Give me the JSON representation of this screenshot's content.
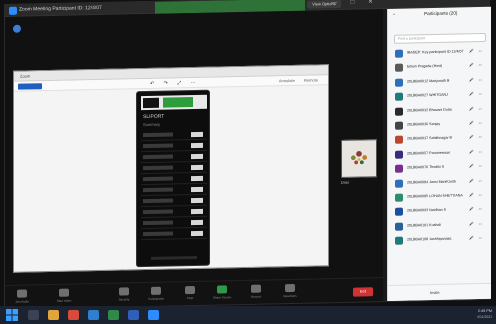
{
  "window": {
    "title": "Zoom Meeting Participant ID: 12/4/07",
    "view_button": "View Options",
    "controls": "— □ ✕"
  },
  "shared_screen": {
    "tab_label": "Zoom",
    "toolbar_right": [
      "Annotate",
      "Remote"
    ],
    "phone": {
      "title": "SLIPORT",
      "subtitle": "Summary",
      "rows": 10
    }
  },
  "thumbnail": {
    "label": "Dimi"
  },
  "control_bar": {
    "items": [
      {
        "label": "Join Audio",
        "icon": "headphones-icon"
      },
      {
        "label": "Stop Video",
        "icon": "video-icon"
      },
      {
        "label": "Security",
        "icon": "shield-icon"
      },
      {
        "label": "Participants",
        "icon": "people-icon"
      },
      {
        "label": "Chat",
        "icon": "chat-icon"
      },
      {
        "label": "Share Screen",
        "icon": "share-icon"
      },
      {
        "label": "Record",
        "icon": "record-icon"
      },
      {
        "label": "Reactions",
        "icon": "smile-icon"
      }
    ],
    "end_label": "End"
  },
  "participants": {
    "title": "Participants (20)",
    "search_placeholder": "Find a participant",
    "invite_label": "Invite",
    "items": [
      {
        "name": "IBADEP: Key participant ID 12/4/07",
        "avatar_color": "#2f6fb8"
      },
      {
        "name": "Edwin Pragada (Host)",
        "avatar_color": "#5a5a5a"
      },
      {
        "name": "20LBBA0012 Manjunath B",
        "avatar_color": "#2f6fb8"
      },
      {
        "name": "20LBBA0027 WHITGANJ",
        "avatar_color": "#1f7a7a"
      },
      {
        "name": "20LBBA0032 Bhavani Dutta",
        "avatar_color": "#2a2a2a"
      },
      {
        "name": "20LBBA0036 Sanjay",
        "avatar_color": "#444444"
      },
      {
        "name": "20LBBA0037 Sahithnagar B",
        "avatar_color": "#b8482f"
      },
      {
        "name": "20LBBA0057 Parameswari",
        "avatar_color": "#3d2b7a"
      },
      {
        "name": "20LBBA0070 Thodiki S",
        "avatar_color": "#7a2f8c"
      },
      {
        "name": "20LBBA0084 Jansi ManiKanth",
        "avatar_color": "#2f6fb8"
      },
      {
        "name": "20LBBA0085 LOHAN SHETTIANA",
        "avatar_color": "#2f8c6a"
      },
      {
        "name": "20LBBA0093 Naidhan S",
        "avatar_color": "#1d4f9a"
      },
      {
        "name": "20LBBA0101 Kushali",
        "avatar_color": "#2a5f9a"
      },
      {
        "name": "20LBBA0108 Jashhipanaka",
        "avatar_color": "#1f7a7a"
      }
    ]
  },
  "taskbar": {
    "time": "2:45 PM",
    "date": "4/11/2021",
    "apps": [
      {
        "icon": "search-icon",
        "color": "#3a4254"
      },
      {
        "icon": "folder-icon",
        "color": "#e0a63a"
      },
      {
        "icon": "chrome-icon",
        "color": "#d84a3a"
      },
      {
        "icon": "edge-icon",
        "color": "#2f7fd0"
      },
      {
        "icon": "excel-icon",
        "color": "#2f8a4a"
      },
      {
        "icon": "word-icon",
        "color": "#2f5fb8"
      },
      {
        "icon": "zoom-icon",
        "color": "#2d8cff"
      }
    ]
  }
}
